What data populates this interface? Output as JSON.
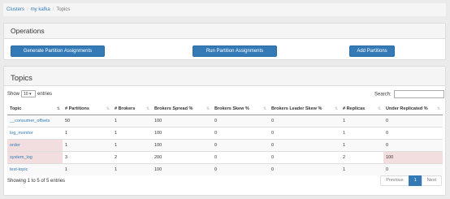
{
  "breadcrumb": {
    "clusters": "Clusters",
    "cluster": "my kafka",
    "current": "Topics"
  },
  "operations": {
    "title": "Operations",
    "generate_label": "Generate Partition Assignments",
    "run_label": "Run Partition Assignments",
    "add_label": "Add Partitions"
  },
  "topics": {
    "title": "Topics",
    "show_label": "Show",
    "entries_label": "entries",
    "length_value": "10",
    "search_label": "Search:",
    "search_value": "",
    "columns": [
      "Topic",
      "# Partitions",
      "# Brokers",
      "Brokers Spread %",
      "Brokers Skew %",
      "Brokers Leader Skew %",
      "# Replicas",
      "Under Replicated %"
    ],
    "rows": [
      {
        "topic": "__consumer_offsets",
        "partitions": "50",
        "brokers": "1",
        "spread": "100",
        "skew": "0",
        "leader_skew": "0",
        "replicas": "1",
        "under_replicated": "0"
      },
      {
        "topic": "log_monitor",
        "partitions": "1",
        "brokers": "1",
        "spread": "100",
        "skew": "0",
        "leader_skew": "0",
        "replicas": "1",
        "under_replicated": "0"
      },
      {
        "topic": "order",
        "partitions": "1",
        "brokers": "1",
        "spread": "100",
        "skew": "0",
        "leader_skew": "0",
        "replicas": "1",
        "under_replicated": "0"
      },
      {
        "topic": "system_log",
        "partitions": "3",
        "brokers": "2",
        "spread": "200",
        "skew": "0",
        "leader_skew": "0",
        "replicas": "2",
        "under_replicated": "100"
      },
      {
        "topic": "test-topic",
        "partitions": "1",
        "brokers": "1",
        "spread": "100",
        "skew": "0",
        "leader_skew": "0",
        "replicas": "1",
        "under_replicated": "0"
      }
    ],
    "info": "Showing 1 to 5 of 5 entries",
    "pagination": {
      "previous": "Previous",
      "page": "1",
      "next": "Next"
    }
  }
}
